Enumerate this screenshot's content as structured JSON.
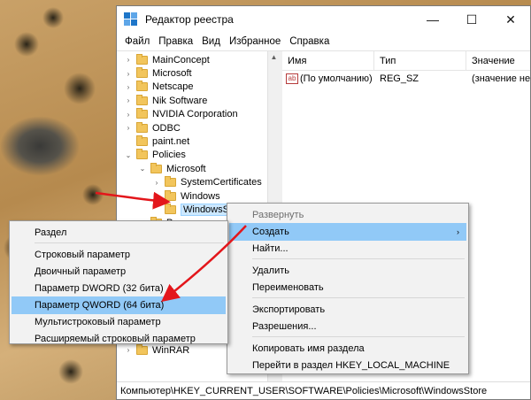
{
  "window": {
    "title": "Редактор реестра",
    "controls": {
      "minimize": "—",
      "maximize": "☐",
      "close": "✕"
    }
  },
  "menubar": [
    "Файл",
    "Правка",
    "Вид",
    "Избранное",
    "Справка"
  ],
  "tree": {
    "items": [
      {
        "label": "MainConcept",
        "expander": "›",
        "indent": 0
      },
      {
        "label": "Microsoft",
        "expander": "›",
        "indent": 0
      },
      {
        "label": "Netscape",
        "expander": "›",
        "indent": 0
      },
      {
        "label": "Nik Software",
        "expander": "›",
        "indent": 0
      },
      {
        "label": "NVIDIA Corporation",
        "expander": "›",
        "indent": 0
      },
      {
        "label": "ODBC",
        "expander": "›",
        "indent": 0
      },
      {
        "label": "paint.net",
        "expander": "",
        "indent": 0
      },
      {
        "label": "Policies",
        "expander": "⌄",
        "indent": 0
      },
      {
        "label": "Microsoft",
        "expander": "⌄",
        "indent": 1
      },
      {
        "label": "SystemCertificates",
        "expander": "›",
        "indent": 2
      },
      {
        "label": "Windows",
        "expander": "›",
        "indent": 2
      },
      {
        "label": "WindowsStore",
        "expander": "",
        "indent": 2,
        "selected": true
      },
      {
        "label": "Power",
        "expander": "›",
        "indent": 1
      }
    ],
    "bottom_item": {
      "label": "WinRAR",
      "expander": "›"
    }
  },
  "list": {
    "columns": [
      "Имя",
      "Тип",
      "Значение"
    ],
    "rows": [
      {
        "icon": "ab",
        "name": "(По умолчанию)",
        "type": "REG_SZ",
        "value": "(значение не"
      }
    ]
  },
  "statusbar": {
    "path": "Компьютер\\HKEY_CURRENT_USER\\SOFTWARE\\Policies\\Microsoft\\WindowsStore"
  },
  "context_menu": {
    "items": [
      {
        "label": "Развернуть",
        "disabled": true
      },
      {
        "label": "Создать",
        "highlighted": true,
        "submenu": "›"
      },
      {
        "label": "Найти..."
      },
      {
        "separator": true
      },
      {
        "label": "Удалить"
      },
      {
        "label": "Переименовать"
      },
      {
        "separator": true
      },
      {
        "label": "Экспортировать"
      },
      {
        "label": "Разрешения..."
      },
      {
        "separator": true
      },
      {
        "label": "Копировать имя раздела"
      },
      {
        "label": "Перейти в раздел HKEY_LOCAL_MACHINE"
      }
    ]
  },
  "submenu": {
    "items": [
      {
        "label": "Раздел"
      },
      {
        "separator": true
      },
      {
        "label": "Строковый параметр"
      },
      {
        "label": "Двоичный параметр"
      },
      {
        "label": "Параметр DWORD (32 бита)"
      },
      {
        "label": "Параметр QWORD (64 бита)",
        "highlighted": true
      },
      {
        "label": "Мультистроковый параметр"
      },
      {
        "label": "Расширяемый строковый параметр"
      }
    ]
  },
  "colors": {
    "highlight": "#91c9f7",
    "selection": "#cce8ff",
    "annotation_arrow": "#e3161b"
  }
}
